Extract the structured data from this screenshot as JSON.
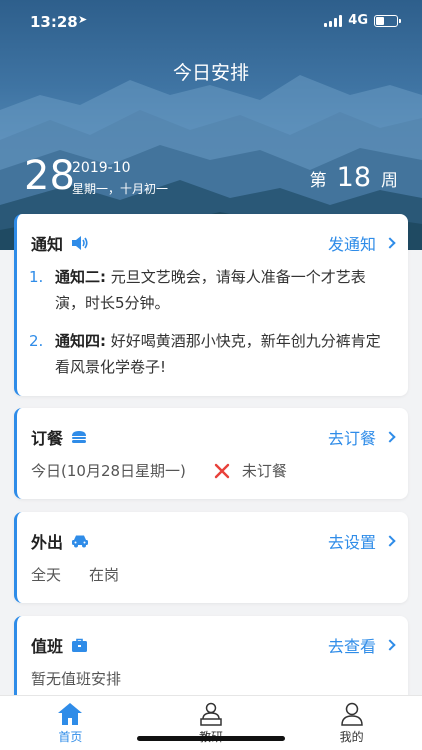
{
  "status_bar": {
    "time": "13:28",
    "network": "4G"
  },
  "header": {
    "title": "今日安排",
    "day": "28",
    "year_month": "2019-10",
    "weekday_lunar": "星期一，十月初一",
    "week_prefix": "第",
    "week_number": "18",
    "week_suffix": "周"
  },
  "notice": {
    "title": "通知",
    "link": "发通知",
    "items": [
      {
        "num": "1.",
        "label": "通知二:",
        "text": "元旦文艺晚会，请每人准备一个才艺表演，时长5分钟。"
      },
      {
        "num": "2.",
        "label": "通知四:",
        "text": "好好喝黄酒那小快克，新年创九分裤肯定看风景化学卷子!"
      }
    ]
  },
  "meal": {
    "title": "订餐",
    "link": "去订餐",
    "date": "今日(10月28日星期一)",
    "status": "未订餐"
  },
  "outing": {
    "title": "外出",
    "link": "去设置",
    "time": "全天",
    "status": "在岗"
  },
  "duty": {
    "title": "值班",
    "link": "去查看",
    "text": "暂无值班安排"
  },
  "tabs": [
    {
      "label": "首页",
      "icon": "home-icon",
      "active": true
    },
    {
      "label": "教研",
      "icon": "teacher-desk-icon",
      "active": false
    },
    {
      "label": "我的",
      "icon": "person-icon",
      "active": false
    }
  ],
  "colors": {
    "accent": "#2f8ce8",
    "error": "#e8403a"
  }
}
